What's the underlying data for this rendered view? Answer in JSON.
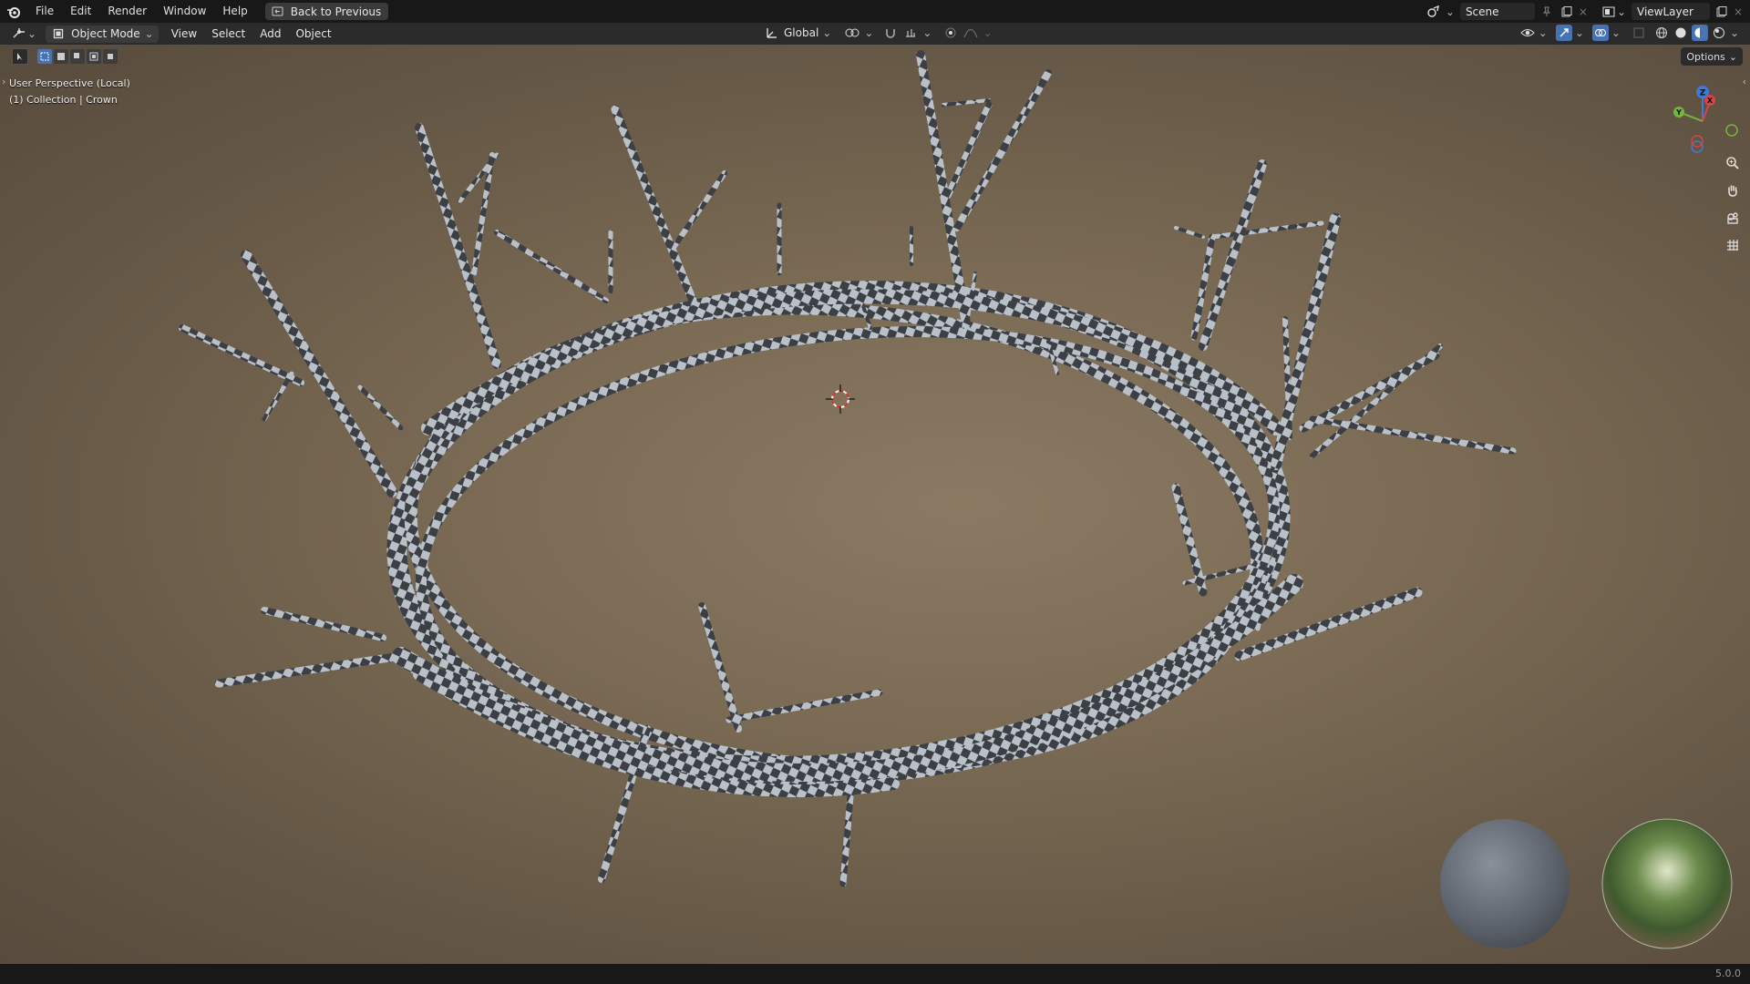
{
  "menu": {
    "file": "File",
    "edit": "Edit",
    "render": "Render",
    "window": "Window",
    "help": "Help",
    "back_to_previous": "Back to Previous"
  },
  "scene": {
    "name": "Scene",
    "view_layer": "ViewLayer"
  },
  "header": {
    "mode": "Object Mode",
    "view": "View",
    "select": "Select",
    "add": "Add",
    "object": "Object",
    "transform_orientation": "Global",
    "options": "Options"
  },
  "viewport": {
    "perspective": "User Perspective (Local)",
    "collection": "(1) Collection | Crown",
    "gizmo_axes": [
      "Z",
      "X",
      "Y"
    ],
    "object_colors": {
      "bg": "#7b6b55",
      "checker_light": "#b9c0c7",
      "checker_dark": "#3c3f44"
    }
  },
  "status": {
    "version": "5.0.0"
  }
}
